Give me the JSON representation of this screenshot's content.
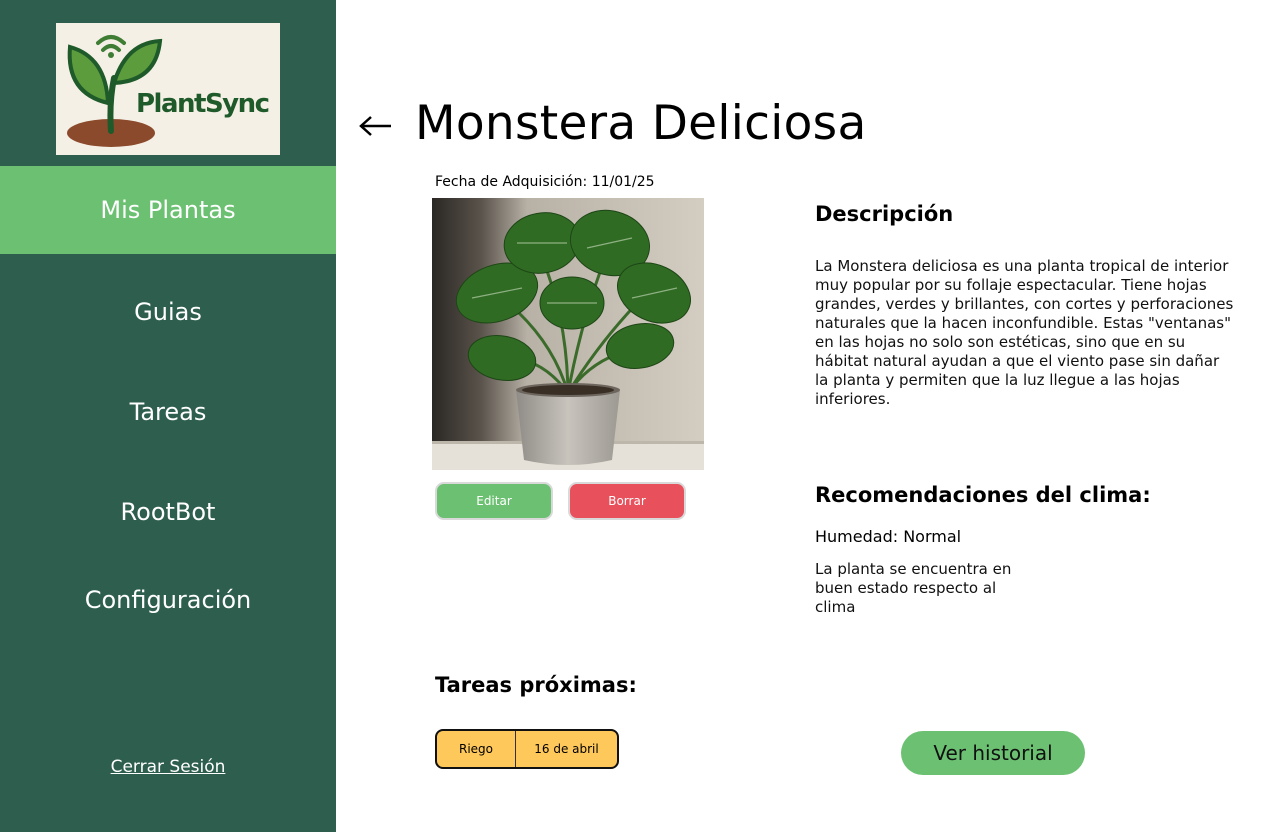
{
  "app": {
    "name": "PlantSync",
    "colors": {
      "sidebar": "#2e5e4e",
      "accent_green": "#6cc072",
      "danger_red": "#e8505b",
      "task_yellow": "#ffc85a"
    }
  },
  "sidebar": {
    "logo_text": "PlantSync",
    "items": [
      {
        "label": "Mis Plantas",
        "active": true
      },
      {
        "label": "Guias",
        "active": false
      },
      {
        "label": "Tareas",
        "active": false
      },
      {
        "label": "RootBot",
        "active": false
      },
      {
        "label": "Configuración",
        "active": false
      }
    ],
    "logout_label": "Cerrar Sesión"
  },
  "plant": {
    "back_icon": "arrow-left-icon",
    "name": "Monstera Deliciosa",
    "acquisition": "Fecha de Adquisición: 11/01/25",
    "edit_label": "Editar",
    "delete_label": "Borrar"
  },
  "description": {
    "title": "Descripción",
    "text": "La Monstera deliciosa es una planta tropical de interior muy popular por su follaje espectacular. Tiene hojas grandes, verdes y brillantes, con cortes y perforaciones naturales que la hacen inconfundible. Estas \"ventanas\" en las hojas no solo son estéticas, sino que en su hábitat natural ayudan a que el viento pase sin dañar la planta y permiten que la luz llegue a las hojas inferiores."
  },
  "climate": {
    "title": "Recomendaciones del clima:",
    "humidity": "Humedad: Normal",
    "status": "La planta se encuentra en buen estado respecto al clima"
  },
  "tasks": {
    "title": "Tareas próximas:",
    "items": [
      {
        "name": "Riego",
        "date": "16 de abril"
      }
    ],
    "history_label": "Ver historial"
  }
}
